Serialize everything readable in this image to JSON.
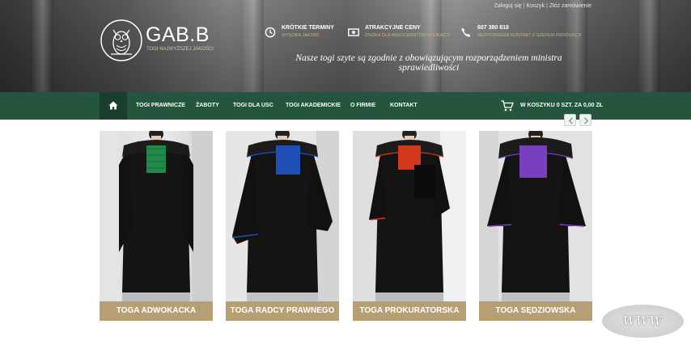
{
  "top_links": [
    "Zaloguj się",
    "Koszyk",
    "Złóż zamówienie"
  ],
  "logo": {
    "brand": "GAB.B",
    "tagline": "TOGI NAJWYŻSZEJ JAKOŚCI",
    "icon": "owl-icon"
  },
  "features": [
    {
      "icon": "clock-icon",
      "title": "KRÓTKIE TERMINY",
      "subtitle": "WYSOKA JAKOŚĆ"
    },
    {
      "icon": "money-icon",
      "title": "ATRAKCYJNE CENY",
      "subtitle": "ZNIŻKA DLA ABSOLWENTÓW APLIKACJI"
    },
    {
      "icon": "phone-icon",
      "title": "607 380 818",
      "subtitle": "BEZPOŚREDNI KONTAKT Z SZEFEM PRODUKCJI"
    }
  ],
  "quote": "Nasze togi szyte są zgodnie z obowiązującym rozporządzeniem ministra sprawiedliwości",
  "nav": {
    "home_icon": "home-icon",
    "items": [
      "TOGI PRAWNICZE",
      "ŻABOTY",
      "TOGI DLA USC",
      "TOGI AKADEMICKIE",
      "O FIRMIE",
      "KONTAKT"
    ],
    "cart_icon": "cart-icon",
    "cart_text": "W KOSZYKU 0 SZT. ZA 0,00 ZŁ"
  },
  "products": [
    {
      "label": "TOGA ADWOKACKA",
      "accent": "#1f8a4c"
    },
    {
      "label": "TOGA RADCY PRAWNEGO",
      "accent": "#1f4fb5"
    },
    {
      "label": "TOGA PROKURATORSKA",
      "accent": "#d2361b"
    },
    {
      "label": "TOGA SĘDZIOWSKA",
      "accent": "#7a3fbf"
    }
  ],
  "badge": "WWW",
  "colors": {
    "nav_green": "#25563d",
    "label_gold": "#b69f72",
    "feature_gold": "#c9b37b"
  }
}
